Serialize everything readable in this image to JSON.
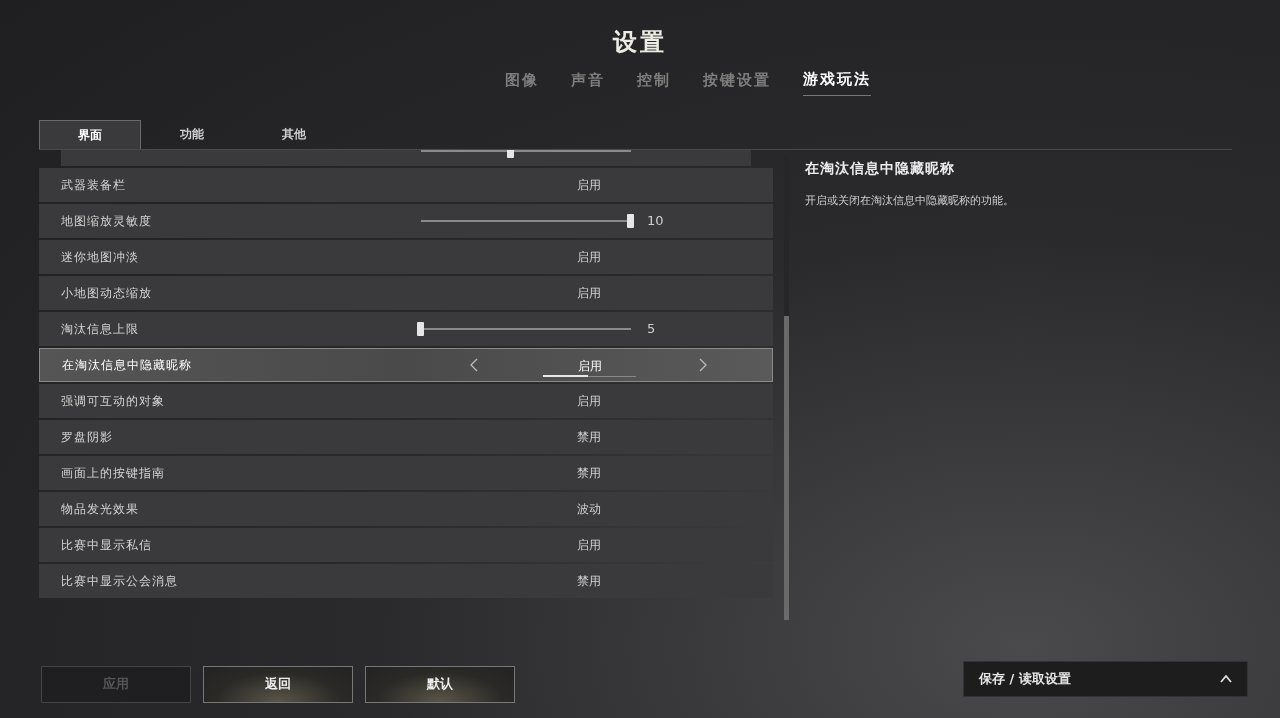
{
  "title": "设置",
  "main_tabs": [
    {
      "label": "图像",
      "selected": false
    },
    {
      "label": "声音",
      "selected": false
    },
    {
      "label": "控制",
      "selected": false
    },
    {
      "label": "按键设置",
      "selected": false
    },
    {
      "label": "游戏玩法",
      "selected": true
    }
  ],
  "sub_tabs": [
    {
      "label": "界面",
      "selected": true
    },
    {
      "label": "功能",
      "selected": false
    },
    {
      "label": "其他",
      "selected": false
    }
  ],
  "clipped_row": {
    "level": 0.43
  },
  "rows": [
    {
      "kind": "toggle",
      "label": "武器装备栏",
      "value": "启用",
      "selected": false
    },
    {
      "kind": "slider",
      "label": "地图缩放灵敏度",
      "level": 1.0,
      "reading": "10",
      "selected": false
    },
    {
      "kind": "toggle",
      "label": "迷你地图冲淡",
      "value": "启用",
      "selected": false
    },
    {
      "kind": "toggle",
      "label": "小地图动态缩放",
      "value": "启用",
      "selected": false
    },
    {
      "kind": "slider",
      "label": "淘汰信息上限",
      "level": 0.0,
      "reading": "5",
      "selected": false
    },
    {
      "kind": "toggle",
      "label": "在淘汰信息中隐藏昵称",
      "value": "启用",
      "selected": true
    },
    {
      "kind": "toggle",
      "label": "强调可互动的对象",
      "value": "启用",
      "selected": false
    },
    {
      "kind": "toggle",
      "label": "罗盘阴影",
      "value": "禁用",
      "selected": false
    },
    {
      "kind": "toggle",
      "label": "画面上的按键指南",
      "value": "禁用",
      "selected": false
    },
    {
      "kind": "toggle",
      "label": "物品发光效果",
      "value": "波动",
      "selected": false
    },
    {
      "kind": "toggle",
      "label": "比赛中显示私信",
      "value": "启用",
      "selected": false
    },
    {
      "kind": "toggle",
      "label": "比赛中显示公会消息",
      "value": "禁用",
      "selected": false
    }
  ],
  "detail": {
    "title": "在淘汰信息中隐藏昵称",
    "description": "开启或关闭在淘汰信息中隐藏昵称的功能。"
  },
  "buttons": [
    {
      "label": "应用",
      "disabled": true
    },
    {
      "label": "返回",
      "disabled": false
    },
    {
      "label": "默认",
      "disabled": false
    }
  ],
  "save_panel": {
    "label": "保存 / 读取设置",
    "expanded": false
  }
}
